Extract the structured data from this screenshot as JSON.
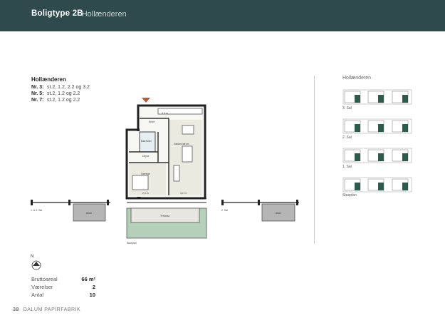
{
  "header": {
    "title": "Boligtype 2B",
    "subtitle": "- Hollænderen"
  },
  "block": {
    "title": "Hollænderen",
    "rows": [
      {
        "label": "Nr. 3:",
        "value": "st.2, 1.2, 2.2 og 3.2"
      },
      {
        "label": "Nr. 5:",
        "value": "st.2, 1.2 og 2.2"
      },
      {
        "label": "Nr. 7:",
        "value": "st.2, 1.2 og 2.2"
      }
    ]
  },
  "plan": {
    "rooms": {
      "entre": "Entré",
      "bad": "Bad/toilet",
      "depot": "Depot",
      "vaerelse": "Værelse",
      "kokken": "Køkken/alrum",
      "terrasse": "Terrasse",
      "altan": "Altan",
      "area1": "2,4 m",
      "area2": "3,1 m",
      "area3": "3,9 m"
    },
    "floor_left": "1. & 3. Sal",
    "floor_right": "2. Sal",
    "bottom_note": "Stueplan"
  },
  "side": {
    "title": "Hollænderen",
    "floors": [
      "3. Sal",
      "2. Sal",
      "1. Sal",
      "Stueplan"
    ]
  },
  "compass": "N",
  "stats": [
    {
      "label": "Bruttoareal",
      "value": "66 m²"
    },
    {
      "label": "Værelser",
      "value": "2"
    },
    {
      "label": "Antal",
      "value": "10"
    }
  ],
  "footer": {
    "page": "38",
    "brand": "DALUM PAPIRFABRIK"
  },
  "colors": {
    "header": "#2f4a4c",
    "accent": "#2f5a4e",
    "marker": "#b85b3f",
    "grass": "#b5d0b9"
  }
}
